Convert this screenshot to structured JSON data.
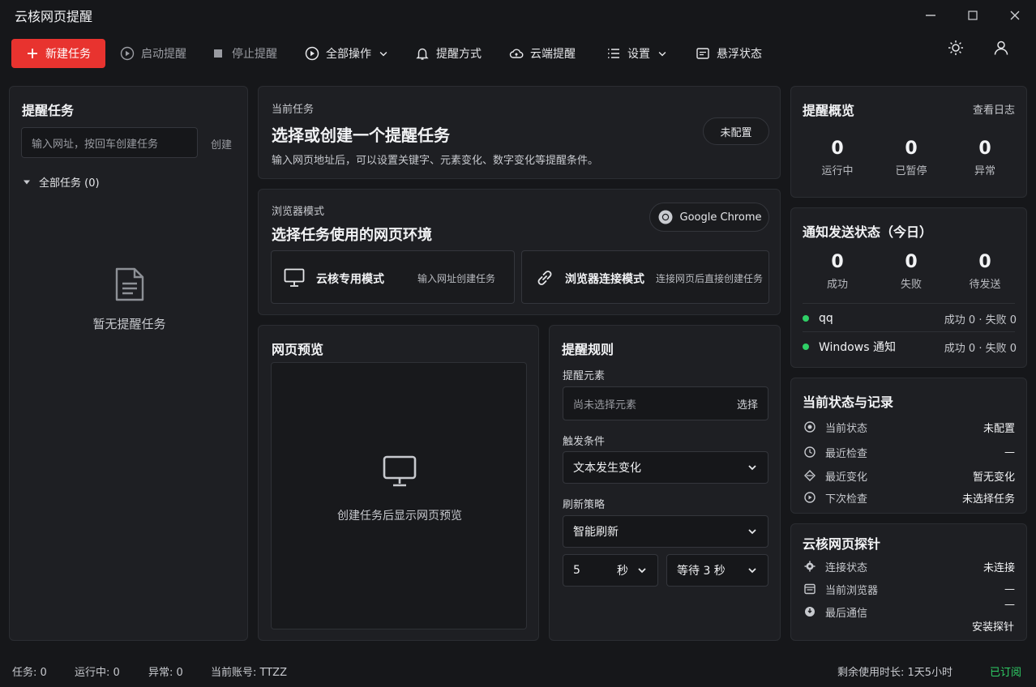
{
  "window": {
    "title": "云核网页提醒"
  },
  "toolbar": {
    "new_task": "新建任务",
    "start": "启动提醒",
    "stop": "停止提醒",
    "all_ops": "全部操作",
    "method": "提醒方式",
    "cloud": "云端提醒",
    "settings": "设置",
    "float": "悬浮状态"
  },
  "tasks": {
    "title": "提醒任务",
    "input_placeholder": "输入网址，按回车创建任务",
    "create": "创建",
    "group": "全部任务 (0)",
    "empty": "暂无提醒任务"
  },
  "current": {
    "label": "当前任务",
    "heading": "选择或创建一个提醒任务",
    "desc": "输入网页地址后，可以设置关键字、元素变化、数字变化等提醒条件。",
    "badge": "未配置"
  },
  "browser": {
    "label": "浏览器模式",
    "heading": "选择任务使用的网页环境",
    "chrome": "Google Chrome",
    "mode1_title": "云核专用模式",
    "mode1_desc": "输入网址创建任务",
    "mode2_title": "浏览器连接模式",
    "mode2_desc": "连接网页后直接创建任务"
  },
  "preview": {
    "title": "网页预览",
    "empty": "创建任务后显示网页预览"
  },
  "rules": {
    "title": "提醒规则",
    "element_label": "提醒元素",
    "element_placeholder": "尚未选择元素",
    "element_select": "选择",
    "trigger_label": "触发条件",
    "trigger_value": "文本发生变化",
    "refresh_label": "刷新策略",
    "refresh_value": "智能刷新",
    "interval_value": "5",
    "interval_unit": "秒",
    "wait_value": "等待 3 秒"
  },
  "overview": {
    "title": "提醒概览",
    "log_link": "查看日志",
    "stats": [
      {
        "num": "0",
        "label": "运行中"
      },
      {
        "num": "0",
        "label": "已暂停"
      },
      {
        "num": "0",
        "label": "异常"
      }
    ]
  },
  "notify": {
    "title": "通知发送状态（今日）",
    "stats": [
      {
        "num": "0",
        "label": "成功"
      },
      {
        "num": "0",
        "label": "失败"
      },
      {
        "num": "0",
        "label": "待发送"
      }
    ],
    "channels": [
      {
        "name": "qq",
        "status": "成功 0 · 失败 0"
      },
      {
        "name": "Windows 通知",
        "status": "成功 0 · 失败 0"
      }
    ],
    "dot_color": "#2fcf66"
  },
  "state": {
    "title": "当前状态与记录",
    "rows": [
      {
        "k": "当前状态",
        "v": "未配置"
      },
      {
        "k": "最近检查",
        "v": "—"
      },
      {
        "k": "最近变化",
        "v": "暂无变化"
      },
      {
        "k": "下次检查",
        "v": "未选择任务"
      }
    ]
  },
  "probe": {
    "title": "云核网页探针",
    "rows": [
      {
        "k": "连接状态",
        "v": "未连接"
      },
      {
        "k": "当前浏览器",
        "v": "—"
      },
      {
        "k": "最后通信",
        "v": "—"
      }
    ],
    "install": "安装探针"
  },
  "statusbar": {
    "tasks": "任务: 0",
    "running": "运行中: 0",
    "errors": "异常: 0",
    "account": "当前账号: TTZZ",
    "remaining": "剩余使用时长: 1天5小时",
    "subscribed": "已订阅"
  },
  "colors": {
    "accent": "#e8332f",
    "success": "#2fcf66",
    "background": "#16171a",
    "panel": "#1e1f23"
  }
}
